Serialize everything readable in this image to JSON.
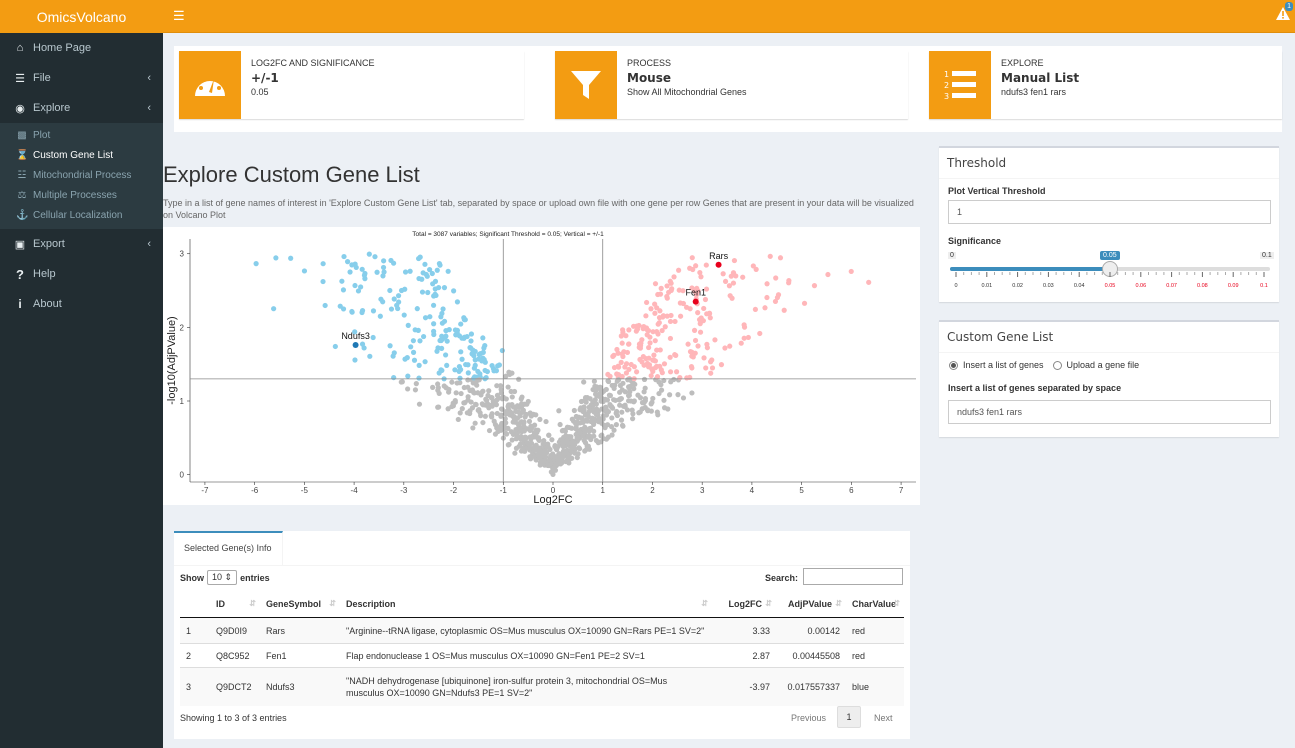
{
  "app": {
    "logo": "OmicsVolcano",
    "alert_count": "1"
  },
  "sidebar": {
    "home": "Home Page",
    "file": "File",
    "explore": "Explore",
    "sub": [
      "Plot",
      "Custom Gene List",
      "Mitochondrial Process",
      "Multiple Processes",
      "Cellular Localization"
    ],
    "export": "Export",
    "help": "Help",
    "about": "About"
  },
  "info": [
    {
      "text": "LOG2FC AND SIGNIFICANCE",
      "number": "+/-1",
      "desc": "0.05"
    },
    {
      "text": "PROCESS",
      "number": "Mouse",
      "desc": "Show All Mitochondrial Genes"
    },
    {
      "text": "EXPLORE",
      "number": "Manual List",
      "desc": "ndufs3 fen1 rars"
    }
  ],
  "main": {
    "title": "Explore Custom Gene List",
    "desc": "Type in a list of gene names of interest in 'Explore Custom Gene List' tab, separated by space or upload own file with one gene per row Genes that are present in your data will be visualized on Volcano Plot"
  },
  "threshold": {
    "title": "Threshold",
    "vlabel": "Plot Vertical Threshold",
    "vvalue": "1",
    "siglabel": "Significance",
    "min": "0",
    "max": "0.1",
    "value": "0.05",
    "value_num": 0.05,
    "ticks": [
      "0",
      "0.01",
      "0.02",
      "0.03",
      "0.04",
      "0.05",
      "0.06",
      "0.07",
      "0.08",
      "0.09",
      "0.1"
    ]
  },
  "custom": {
    "title": "Custom Gene List",
    "radio1": "Insert a list of genes",
    "radio2": "Upload a gene file",
    "label": "Insert a list of genes separated by space",
    "value": "ndufs3 fen1 rars"
  },
  "chart_data": {
    "type": "scatter",
    "title": "Total = 3087 variables; Significant Threshold = 0.05; Vertical = +/-1",
    "xlabel": "Log2FC",
    "ylabel": "-log10(AdjPValue)",
    "xlim": [
      -7.3,
      7.3
    ],
    "ylim": [
      -0.1,
      3.2
    ],
    "xticks": [
      "-7",
      "-6",
      "-5",
      "-4",
      "-3",
      "-2",
      "-1",
      "0",
      "1",
      "2",
      "3",
      "4",
      "5",
      "6",
      "7"
    ],
    "yticks": [
      "0",
      "1",
      "2",
      "3"
    ],
    "vlines": [
      -1,
      1
    ],
    "hline": 1.3,
    "colors": {
      "up": "#ffb6b9",
      "down": "#87ceeb",
      "ns": "#bdbdbd",
      "up_hi": "#e8001c",
      "down_hi": "#1f78b4"
    },
    "highlighted": [
      {
        "label": "Rars",
        "x": 3.33,
        "y": 2.85,
        "group": "up"
      },
      {
        "label": "Fen1",
        "x": 2.87,
        "y": 2.35,
        "group": "up"
      },
      {
        "label": "Ndufs3",
        "x": -3.97,
        "y": 1.76,
        "group": "down"
      }
    ]
  },
  "table": {
    "tab": "Selected Gene(s) Info",
    "show": "Show",
    "entries_val": "10",
    "entries": "entries",
    "search": "Search:",
    "headers": [
      "",
      "ID",
      "GeneSymbol",
      "Description",
      "Log2FC",
      "AdjPValue",
      "CharValue"
    ],
    "rows": [
      [
        "1",
        "Q9D0I9",
        "Rars",
        "\"Arginine--tRNA ligase, cytoplasmic OS=Mus musculus OX=10090 GN=Rars PE=1 SV=2\"",
        "3.33",
        "0.00142",
        "red"
      ],
      [
        "2",
        "Q8C952",
        "Fen1",
        "Flap endonuclease 1 OS=Mus musculus OX=10090 GN=Fen1 PE=2 SV=1",
        "2.87",
        "0.00445508",
        "red"
      ],
      [
        "3",
        "Q9DCT2",
        "Ndufs3",
        "\"NADH dehydrogenase [ubiquinone] iron-sulfur protein 3, mitochondrial OS=Mus musculus OX=10090 GN=Ndufs3 PE=1 SV=2\"",
        "-3.97",
        "0.017557337",
        "blue"
      ]
    ],
    "footer": "Showing 1 to 3 of 3 entries",
    "prev": "Previous",
    "page": "1",
    "next": "Next"
  }
}
